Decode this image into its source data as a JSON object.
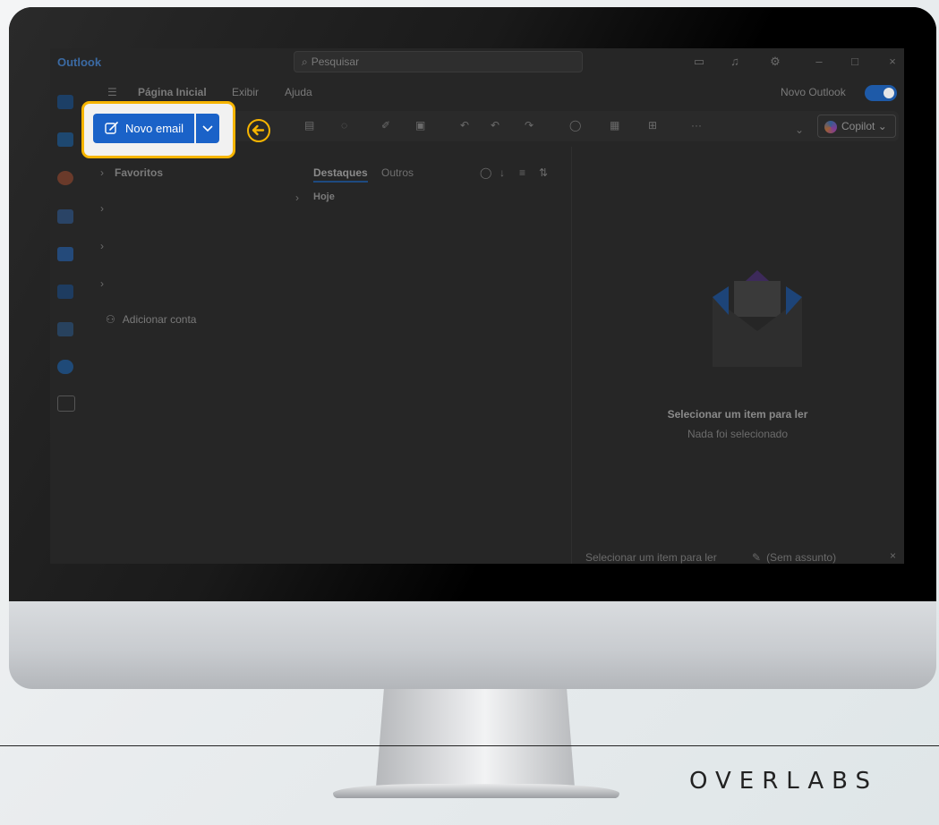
{
  "brand": "OVERLABS",
  "app": {
    "name": "Outlook",
    "search_placeholder": "Pesquisar",
    "tabs": [
      "Página Inicial",
      "Exibir",
      "Ajuda"
    ],
    "new_outlook_label": "Novo Outlook",
    "new_outlook_enabled": true,
    "copilot_label": "Copilot",
    "new_email_label": "Novo email"
  },
  "folders": {
    "favorites": "Favoritos",
    "add_account": "Adicionar conta"
  },
  "message_list": {
    "tabs": [
      "Destaques",
      "Outros"
    ],
    "group_today": "Hoje"
  },
  "reading_pane": {
    "title": "Selecionar um item para ler",
    "subtitle": "Nada foi selecionado"
  },
  "status_bar": {
    "left": "Selecionar um item para ler",
    "right": "(Sem assunto)"
  },
  "colors": {
    "accent": "#1a62c8",
    "highlight": "#f7b500"
  }
}
